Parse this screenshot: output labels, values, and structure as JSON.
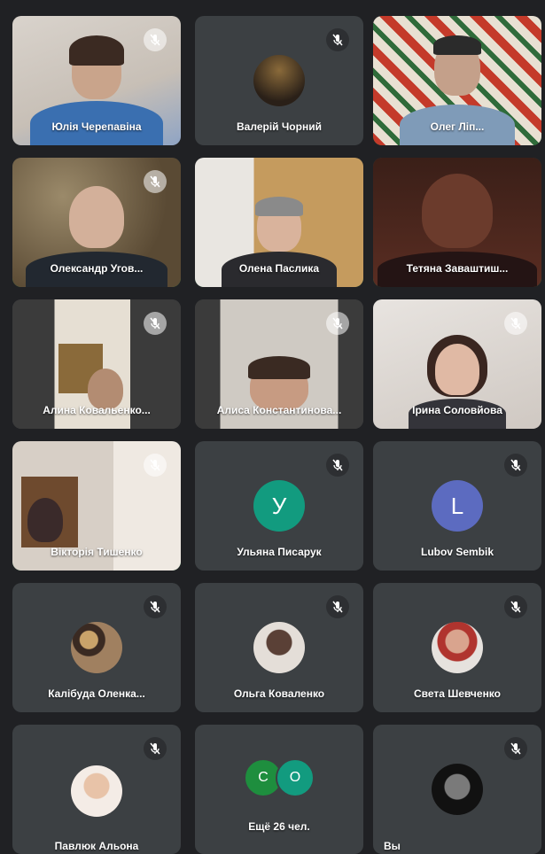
{
  "participants": [
    {
      "name": "Юлія Черепавіна",
      "muted": true
    },
    {
      "name": "Валерій Чорний",
      "muted": true
    },
    {
      "name": "Олег Ліп...",
      "muted": false
    },
    {
      "name": "Олександр Угов...",
      "muted": true
    },
    {
      "name": "Олена Паслика",
      "muted": false
    },
    {
      "name": "Тетяна Заваштиш...",
      "muted": false
    },
    {
      "name": "Алина Ковальенко...",
      "muted": true
    },
    {
      "name": "Алиса Константинова...",
      "muted": true
    },
    {
      "name": "Ірина Соловйова",
      "muted": true
    },
    {
      "name": "Вікторія Тишенко",
      "muted": true
    },
    {
      "name": "Ульяна Писарук",
      "muted": true,
      "initial": "У",
      "avatar_color": "#129b7f"
    },
    {
      "name": "Lubov Sembik",
      "muted": true,
      "initial": "L",
      "avatar_color": "#5c6bc0"
    },
    {
      "name": "Калібуда Оленка...",
      "muted": true
    },
    {
      "name": "Ольга Коваленко",
      "muted": true
    },
    {
      "name": "Света Шевченко",
      "muted": true
    },
    {
      "name": "Павлюк Альона",
      "muted": true
    },
    {
      "name": "Ещё 26 чел.",
      "muted": false,
      "others": [
        "C",
        "O"
      ]
    },
    {
      "name": "Вы",
      "muted": true
    }
  ],
  "colors": {
    "background": "#202124",
    "tile": "#3c4043",
    "active_border": "#1e8e3e"
  },
  "icons": {
    "mic_off": "mic-off-icon"
  }
}
